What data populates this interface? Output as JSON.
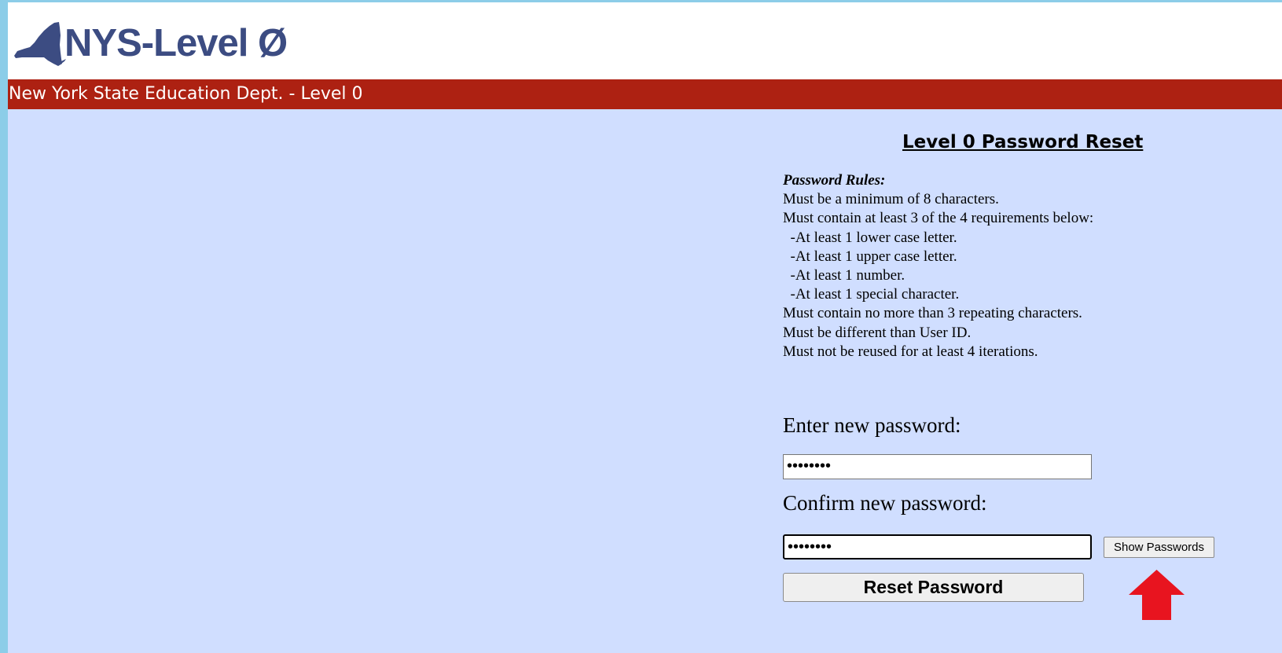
{
  "header": {
    "logo_text": "NYS-Level Ø",
    "logo_icon": "new-york-state-silhouette-icon",
    "banner_text": "New York State Education Dept. - Level 0"
  },
  "main": {
    "title": "Level 0 Password Reset",
    "rules": {
      "heading": "Password Rules:",
      "lines": [
        "Must be a minimum of 8 characters.",
        "Must contain at least 3 of the 4 requirements below:",
        "  -At least 1 lower case letter.",
        "  -At least 1 upper case letter.",
        "  -At least 1 number.",
        "  -At least 1 special character.",
        "Must contain no more than 3 repeating characters.",
        "Must be different than User ID.",
        "Must not be reused for at least 4 iterations."
      ]
    },
    "new_password": {
      "label": "Enter new password:",
      "value": "••••••••"
    },
    "confirm_password": {
      "label": "Confirm new password:",
      "value": "••••••••"
    },
    "show_passwords_label": "Show Passwords",
    "reset_button_label": "Reset Password",
    "annotation": {
      "icon": "up-arrow-icon",
      "color": "#e8141f"
    }
  },
  "colors": {
    "page_background": "#d0deff",
    "banner": "#ad2112",
    "logo": "#3c4c82",
    "outer_border": "#8ccde8"
  }
}
